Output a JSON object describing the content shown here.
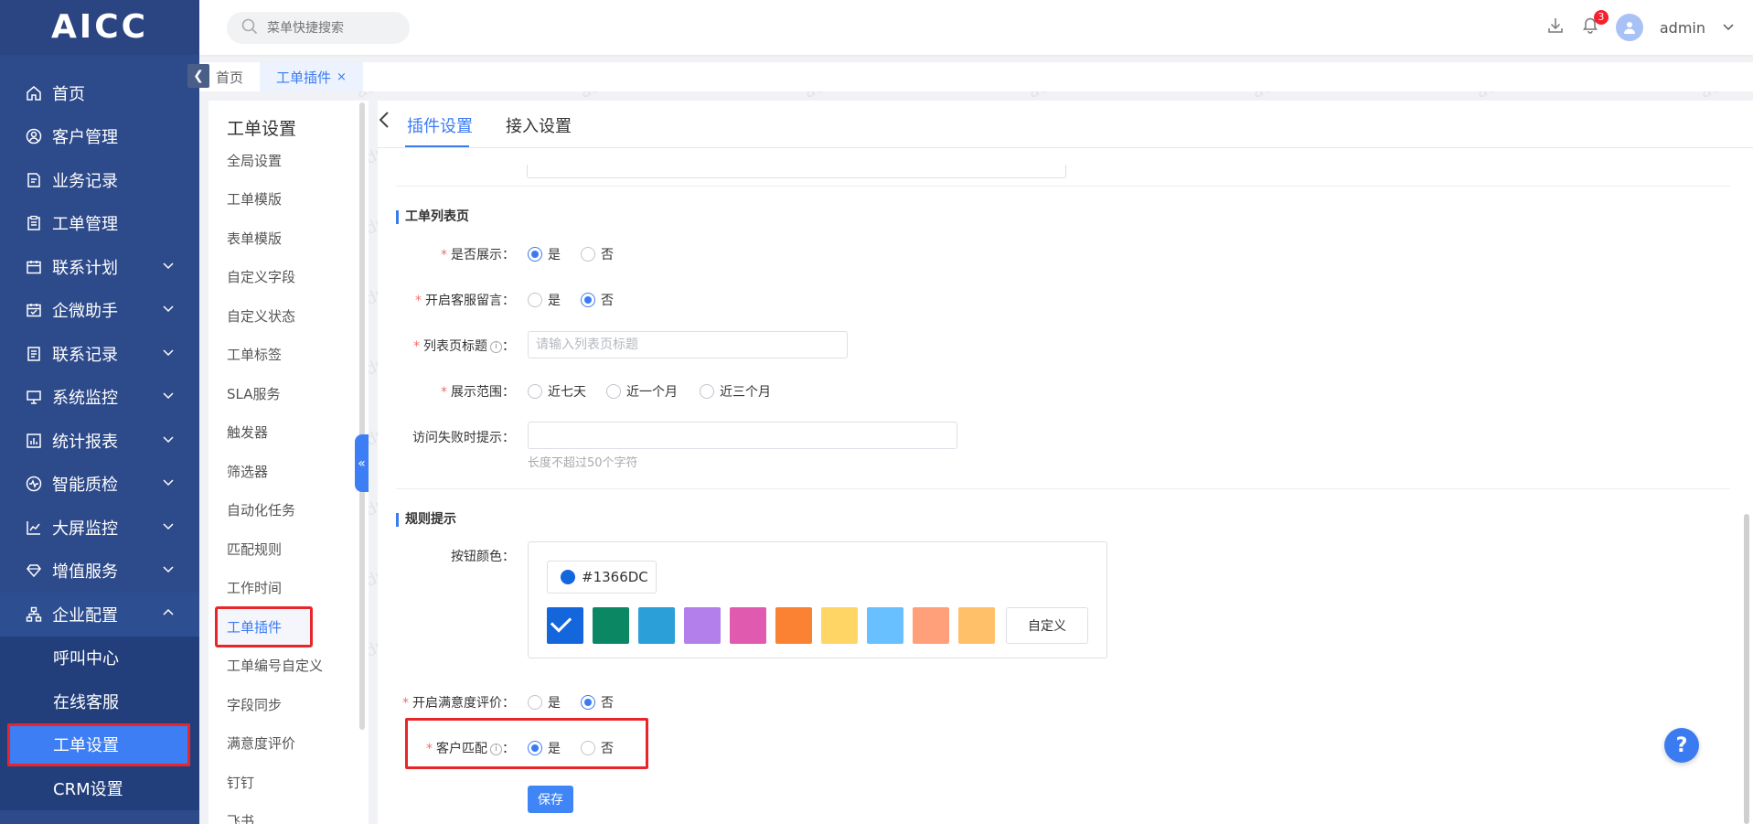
{
  "app": {
    "logo": "AICC"
  },
  "sidebar": {
    "items": [
      {
        "label": "首页",
        "icon": "home-icon",
        "has_children": false
      },
      {
        "label": "客户管理",
        "icon": "user-circle-icon",
        "has_children": false
      },
      {
        "label": "业务记录",
        "icon": "edit-doc-icon",
        "has_children": false
      },
      {
        "label": "工单管理",
        "icon": "clipboard-icon",
        "has_children": false
      },
      {
        "label": "联系计划",
        "icon": "calendar-icon",
        "has_children": true
      },
      {
        "label": "企微助手",
        "icon": "calendar-check-icon",
        "has_children": true
      },
      {
        "label": "联系记录",
        "icon": "doc-list-icon",
        "has_children": true
      },
      {
        "label": "系统监控",
        "icon": "monitor-icon",
        "has_children": true
      },
      {
        "label": "统计报表",
        "icon": "bar-chart-icon",
        "has_children": true
      },
      {
        "label": "智能质检",
        "icon": "pulse-icon",
        "has_children": true
      },
      {
        "label": "大屏监控",
        "icon": "line-chart-icon",
        "has_children": true
      },
      {
        "label": "增值服务",
        "icon": "diamond-icon",
        "has_children": true
      },
      {
        "label": "企业配置",
        "icon": "org-tree-icon",
        "has_children": true,
        "expanded": true
      }
    ],
    "sub_items": [
      {
        "label": "呼叫中心",
        "active": false
      },
      {
        "label": "在线客服",
        "active": false
      },
      {
        "label": "工单设置",
        "active": true
      },
      {
        "label": "CRM设置",
        "active": false
      }
    ]
  },
  "header": {
    "search_placeholder": "菜单快捷搜索",
    "notification_count": "3",
    "username": "admin"
  },
  "tabs": [
    {
      "label": "首页",
      "active": false
    },
    {
      "label": "工单插件",
      "active": true,
      "close": "×"
    }
  ],
  "submenu": {
    "title": "工单设置",
    "items": [
      "全局设置",
      "工单模版",
      "表单模版",
      "自定义字段",
      "自定义状态",
      "工单标签",
      "SLA服务",
      "触发器",
      "筛选器",
      "自动化任务",
      "匹配规则",
      "工作时间",
      "工单插件",
      "工单编号自定义",
      "字段同步",
      "满意度评价",
      "钉钉",
      "飞书"
    ],
    "active_index": 12
  },
  "main": {
    "tabs": [
      "插件设置",
      "接入设置"
    ],
    "active_tab": 0,
    "list_section": {
      "title": "工单列表页",
      "show_label": "是否展示",
      "show_yes": "是",
      "show_no": "否",
      "show_value": "yes",
      "message_label": "开启客服留言",
      "message_yes": "是",
      "message_no": "否",
      "message_value": "no",
      "list_title_label": "列表页标题",
      "list_title_placeholder": "请输入列表页标题",
      "range_label": "展示范围",
      "range_options": [
        "近七天",
        "近一个月",
        "近三个月"
      ],
      "fail_label": "访问失败时提示",
      "fail_hint": "长度不超过50个字符"
    },
    "rule_section": {
      "title": "规则提示",
      "button_color_label": "按钮颜色",
      "color_value": "#1366DC",
      "swatches": [
        "#1366DC",
        "#0B8764",
        "#2A9FD8",
        "#B37FEB",
        "#E05BAF",
        "#FA8232",
        "#FFD666",
        "#69C0FF",
        "#FFA07A",
        "#FFC069"
      ],
      "custom_label": "自定义",
      "satisfaction_label": "开启满意度评价",
      "satisfaction_yes": "是",
      "satisfaction_no": "否",
      "satisfaction_value": "no",
      "match_label": "客户匹配",
      "match_yes": "是",
      "match_no": "否",
      "match_value": "yes",
      "save_label": "保存"
    }
  },
  "help": {
    "label": "?"
  },
  "watermark": "admin",
  "colors": {
    "sidebar_bg": "#2d4a8a",
    "accent": "#3b7bf2",
    "highlight_border": "#e8262a"
  }
}
